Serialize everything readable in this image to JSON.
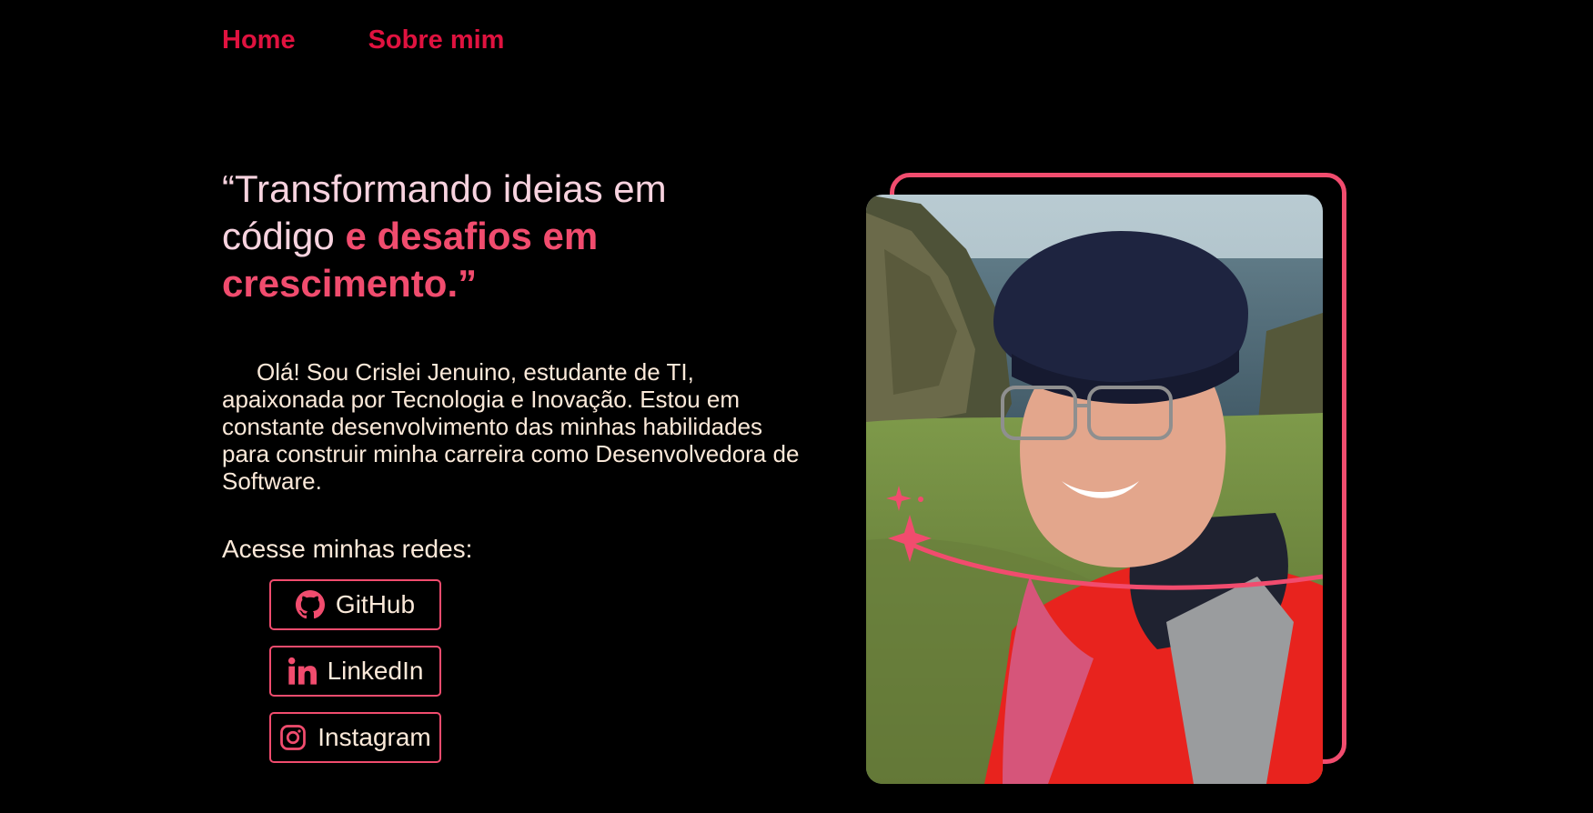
{
  "nav": {
    "home": "Home",
    "about": "Sobre mim"
  },
  "hero": {
    "headline_part1": "“Transformando ideias em código ",
    "headline_part2": "e desafios em crescimento.”",
    "intro": "Olá! Sou Crislei Jenuino, estudante de TI, apaixonada por Tecnologia e Inovação. Estou em constante desenvolvimento das minhas habilidades para construir minha carreira como Desenvolvedora de Software.",
    "networks_title": "Acesse minhas redes:"
  },
  "social": [
    {
      "label": "GitHub",
      "icon": "github-icon"
    },
    {
      "label": "LinkedIn",
      "icon": "linkedin-icon"
    },
    {
      "label": "Instagram",
      "icon": "instagram-icon"
    }
  ],
  "colors": {
    "background": "#000000",
    "nav_accent": "#e0123f",
    "accent": "#f14c6e",
    "text": "#fbe9d9",
    "headline_text": "#f8d3df"
  }
}
